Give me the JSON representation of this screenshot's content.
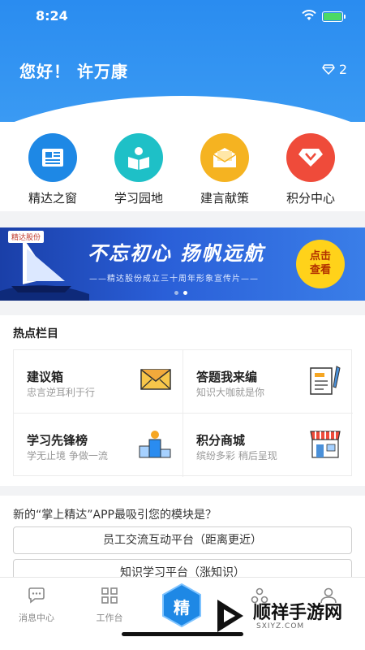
{
  "status": {
    "time": "8:24"
  },
  "header": {
    "greeting": "您好！ 许万康",
    "gem_count": "2"
  },
  "quick_links": [
    {
      "label": "精达之窗",
      "color": "#1e88e5"
    },
    {
      "label": "学习园地",
      "color": "#1ec0c7"
    },
    {
      "label": "建言献策",
      "color": "#f5b321"
    },
    {
      "label": "积分中心",
      "color": "#ef4b3a"
    }
  ],
  "banner": {
    "logo": "精达股份",
    "title": "不忘初心 扬帆远航",
    "subtitle": "——精达股份成立三十周年形象宣传片——",
    "cta": [
      "点击",
      "查看"
    ]
  },
  "hot": {
    "heading": "热点栏目",
    "items": [
      {
        "title": "建议箱",
        "desc": "忠言逆耳利于行"
      },
      {
        "title": "答题我来编",
        "desc": "知识大咖就是你"
      },
      {
        "title": "学习先锋榜",
        "desc": "学无止境 争做一流"
      },
      {
        "title": "积分商城",
        "desc": "缤纷多彩 稍后呈现"
      }
    ]
  },
  "survey": {
    "question": "新的“掌上精达”APP最吸引您的模块是？",
    "options": [
      "员工交流互动平台（距离更近）",
      "知识学习平台（涨知识）"
    ]
  },
  "tabbar": {
    "tabs": [
      "消息中心",
      "工作台"
    ],
    "center": "精"
  },
  "watermark": {
    "name": "顺祥手游网",
    "url": "SXIYZ.COM"
  }
}
